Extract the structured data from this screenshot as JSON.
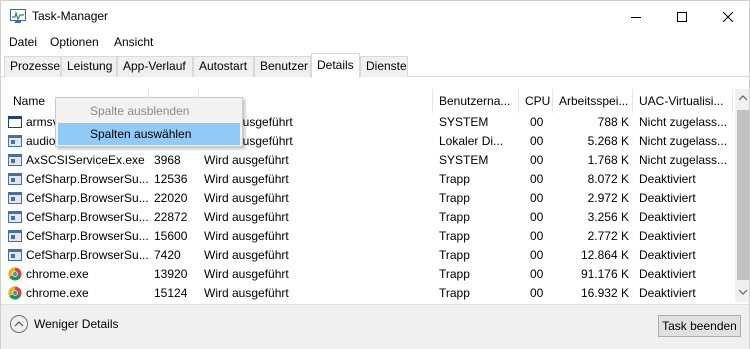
{
  "window": {
    "title": "Task-Manager"
  },
  "menu": [
    "Datei",
    "Optionen",
    "Ansicht"
  ],
  "tabs": [
    "Prozesse",
    "Leistung",
    "App-Verlauf",
    "Autostart",
    "Benutzer",
    "Details",
    "Dienste"
  ],
  "active_tab": "Details",
  "columns": [
    "Name",
    "Benutzerna...",
    "CPU",
    "Arbeitsspei...",
    "UAC-Virtualisi..."
  ],
  "rows": [
    {
      "name": "armsv",
      "pid": "",
      "status": "ausgeführt",
      "user": "SYSTEM",
      "cpu": "00",
      "mem": "788 K",
      "uac": "Nicht zugelass...",
      "icon": "window-icon"
    },
    {
      "name": "audio",
      "pid": "",
      "status": "ausgeführt",
      "user": "Lokaler Di...",
      "cpu": "00",
      "mem": "5.268 K",
      "uac": "Nicht zugelass...",
      "icon": "app-icon"
    },
    {
      "name": "AxSCSIServiceEx.exe",
      "pid": "3968",
      "status": "Wird ausgeführt",
      "user": "SYSTEM",
      "cpu": "00",
      "mem": "1.768 K",
      "uac": "Nicht zugelass...",
      "icon": "app-icon"
    },
    {
      "name": "CefSharp.BrowserSu...",
      "pid": "12536",
      "status": "Wird ausgeführt",
      "user": "Trapp",
      "cpu": "00",
      "mem": "8.072 K",
      "uac": "Deaktiviert",
      "icon": "app-icon"
    },
    {
      "name": "CefSharp.BrowserSu...",
      "pid": "22020",
      "status": "Wird ausgeführt",
      "user": "Trapp",
      "cpu": "00",
      "mem": "2.972 K",
      "uac": "Deaktiviert",
      "icon": "app-icon"
    },
    {
      "name": "CefSharp.BrowserSu...",
      "pid": "22872",
      "status": "Wird ausgeführt",
      "user": "Trapp",
      "cpu": "00",
      "mem": "3.256 K",
      "uac": "Deaktiviert",
      "icon": "app-icon"
    },
    {
      "name": "CefSharp.BrowserSu...",
      "pid": "15600",
      "status": "Wird ausgeführt",
      "user": "Trapp",
      "cpu": "00",
      "mem": "2.772 K",
      "uac": "Deaktiviert",
      "icon": "app-icon"
    },
    {
      "name": "CefSharp.BrowserSu...",
      "pid": "7420",
      "status": "Wird ausgeführt",
      "user": "Trapp",
      "cpu": "00",
      "mem": "12.864 K",
      "uac": "Deaktiviert",
      "icon": "app-icon"
    },
    {
      "name": "chrome.exe",
      "pid": "13920",
      "status": "Wird ausgeführt",
      "user": "Trapp",
      "cpu": "00",
      "mem": "91.176 K",
      "uac": "Deaktiviert",
      "icon": "chrome-icon"
    },
    {
      "name": "chrome.exe",
      "pid": "15124",
      "status": "Wird ausgeführt",
      "user": "Trapp",
      "cpu": "00",
      "mem": "16.932 K",
      "uac": "Deaktiviert",
      "icon": "chrome-icon"
    }
  ],
  "context_menu": {
    "hide_column": "Spalte ausblenden",
    "select_columns": "Spalten auswählen"
  },
  "footer": {
    "fewer_details": "Weniger Details",
    "end_task": "Task beenden"
  }
}
